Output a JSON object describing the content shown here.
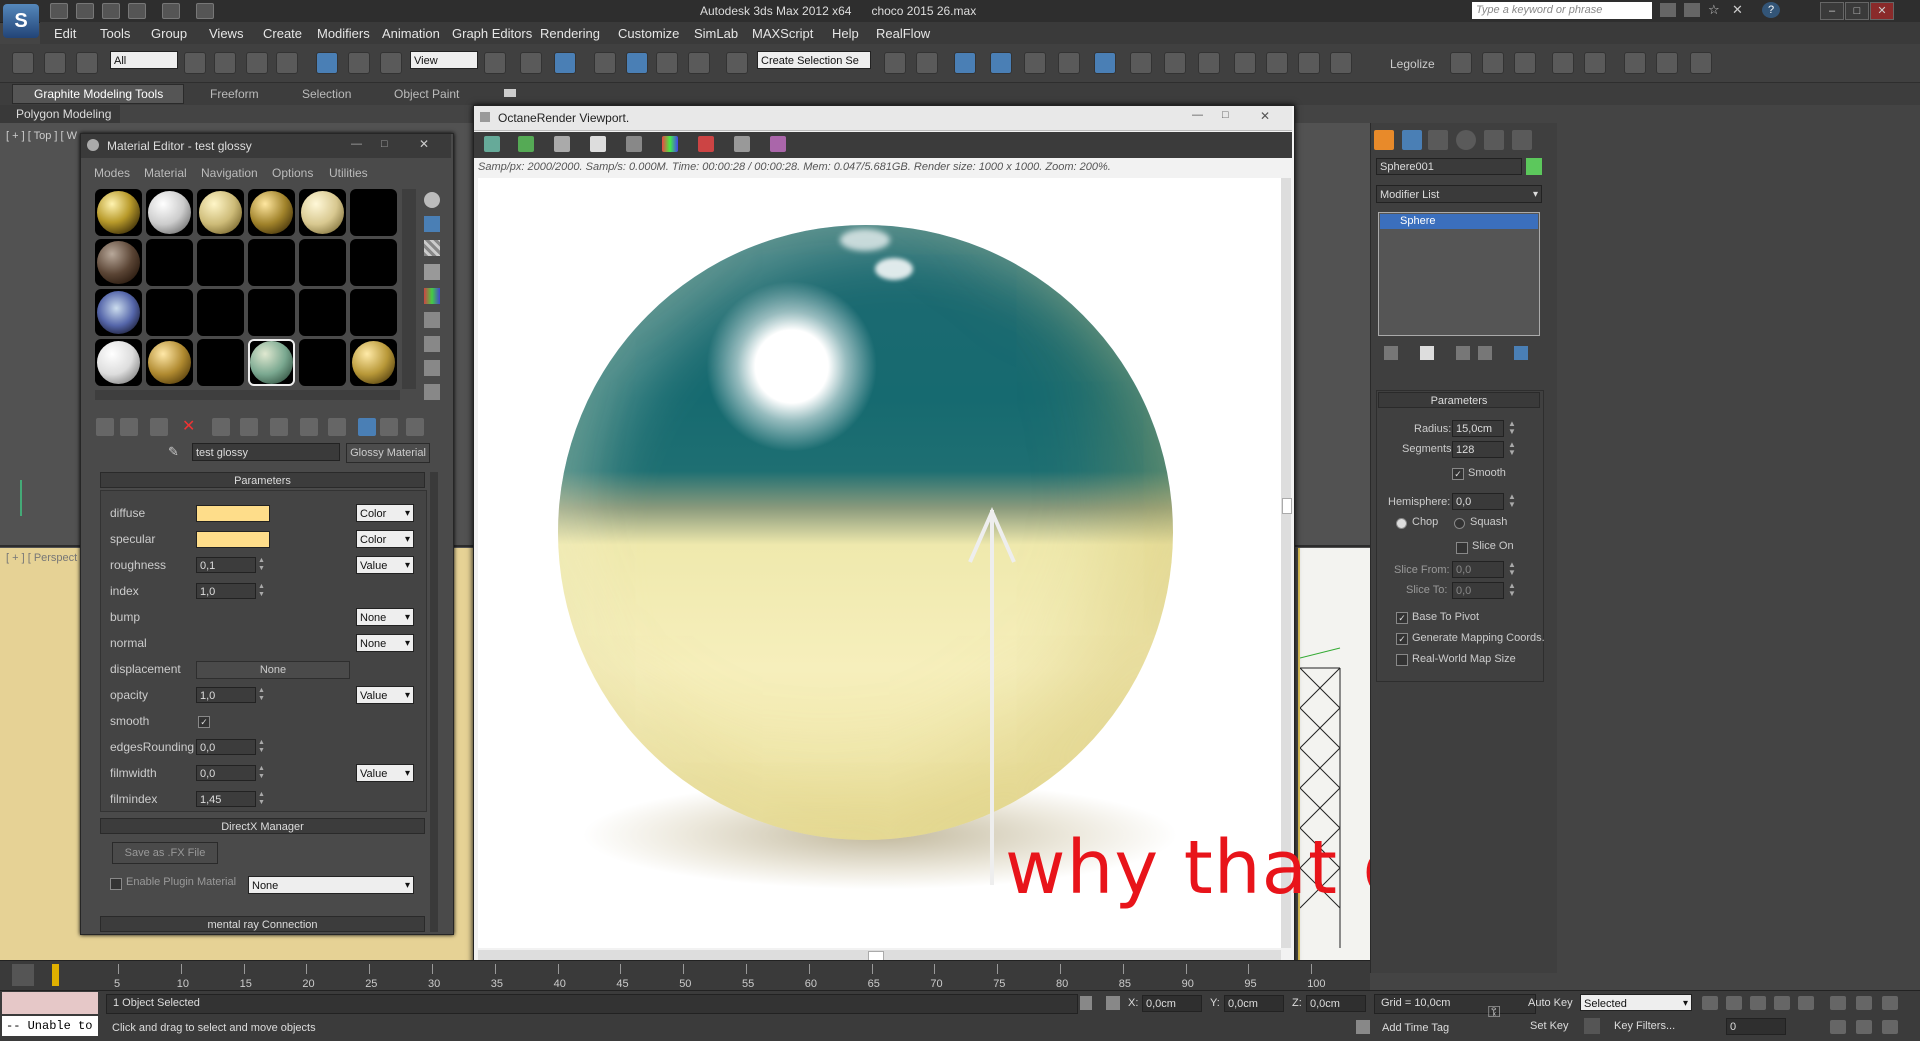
{
  "app": {
    "title": "Autodesk 3ds Max  2012 x64",
    "file": "choco 2015 26.max",
    "search_placeholder": "Type a keyword or phrase",
    "logo_icon": "3dsmax-logo-icon"
  },
  "menu": [
    "Edit",
    "Tools",
    "Group",
    "Views",
    "Create",
    "Modifiers",
    "Animation",
    "Graph Editors",
    "Rendering",
    "Customize",
    "SimLab",
    "MAXScript",
    "Help",
    "RealFlow"
  ],
  "toolbar": {
    "selection_filter": "All",
    "reference_coord": "View",
    "named_selection": "Create Selection Se",
    "legolize": "Legolize"
  },
  "ribbon": {
    "tabs": [
      "Graphite Modeling Tools",
      "Freeform",
      "Selection",
      "Object Paint"
    ],
    "sub": "Polygon Modeling"
  },
  "viewports": {
    "top_label": "[ + ] [ Top ] [ W",
    "persp_label": "[ + ] [ Perspect"
  },
  "material_editor": {
    "title": "Material Editor - test glossy",
    "menu": [
      "Modes",
      "Material",
      "Navigation",
      "Options",
      "Utilities"
    ],
    "material_name": "test glossy",
    "material_type": "Glossy Material",
    "rollout_params": "Parameters",
    "params": [
      {
        "label": "diffuse",
        "kind": "swatch",
        "dd": "Color"
      },
      {
        "label": "specular",
        "kind": "swatch",
        "dd": "Color"
      },
      {
        "label": "roughness",
        "kind": "spin",
        "value": "0,1",
        "dd": "Value"
      },
      {
        "label": "index",
        "kind": "spin",
        "value": "1,0",
        "dd": ""
      },
      {
        "label": "bump",
        "kind": "none",
        "dd": "None"
      },
      {
        "label": "normal",
        "kind": "none",
        "dd": "None"
      },
      {
        "label": "displacement",
        "kind": "wide",
        "value": "None"
      },
      {
        "label": "opacity",
        "kind": "spin",
        "value": "1,0",
        "dd": "Value"
      },
      {
        "label": "smooth",
        "kind": "check",
        "value": "✓"
      },
      {
        "label": "edgesRounding",
        "kind": "spin",
        "value": "0,0",
        "dd": ""
      },
      {
        "label": "filmwidth",
        "kind": "spin",
        "value": "0,0",
        "dd": "Value"
      },
      {
        "label": "filmindex",
        "kind": "spin",
        "value": "1,45",
        "dd": ""
      }
    ],
    "directx": {
      "title": "DirectX Manager",
      "save_fx": "Save as .FX File",
      "enable_plugin": "Enable Plugin Material",
      "plugin_value": "None"
    },
    "mental_ray": "mental ray Connection"
  },
  "octane": {
    "title": "OctaneRender Viewport.",
    "stats": "Samp/px: 2000/2000.    Samp/s: 0.000M.    Time: 00:00:28 / 00:00:28.    Mem: 0.047/5.681GB.    Render size: 1000 x 1000.    Zoom: 200%.",
    "annotation": "why that greenish color ?"
  },
  "command_panel": {
    "object_name": "Sphere001",
    "object_color": "#5cc85c",
    "modifier_list": "Modifier List",
    "stack_item": "Sphere",
    "params_title": "Parameters",
    "radius_label": "Radius:",
    "radius": "15,0cm",
    "segments_label": "Segments:",
    "segments": "128",
    "smooth": "Smooth",
    "hemisphere_label": "Hemisphere:",
    "hemisphere": "0,0",
    "chop": "Chop",
    "squash": "Squash",
    "slice_on": "Slice On",
    "slice_from_label": "Slice From:",
    "slice_from": "0,0",
    "slice_to_label": "Slice To:",
    "slice_to": "0,0",
    "base_to_pivot": "Base To Pivot",
    "gen_mapping": "Generate Mapping Coords.",
    "real_world": "Real-World Map Size"
  },
  "timeline": {
    "ticks": [
      "5",
      "10",
      "15",
      "20",
      "25",
      "30",
      "35",
      "40",
      "45",
      "50",
      "55",
      "60",
      "65",
      "70",
      "75",
      "80",
      "85",
      "90",
      "95",
      "100"
    ]
  },
  "status": {
    "selected": "1 Object Selected",
    "prompt": "Click and drag to select and move objects",
    "unable": "-- Unable to",
    "x_label": "X:",
    "x": "0,0cm",
    "y_label": "Y:",
    "y": "0,0cm",
    "z_label": "Z:",
    "z": "0,0cm",
    "grid": "Grid = 10,0cm",
    "add_time_tag": "Add Time Tag",
    "auto_key": "Auto Key",
    "set_key": "Set Key",
    "auto_value": "Selected",
    "key_filters": "Key Filters...",
    "frame": "0"
  }
}
